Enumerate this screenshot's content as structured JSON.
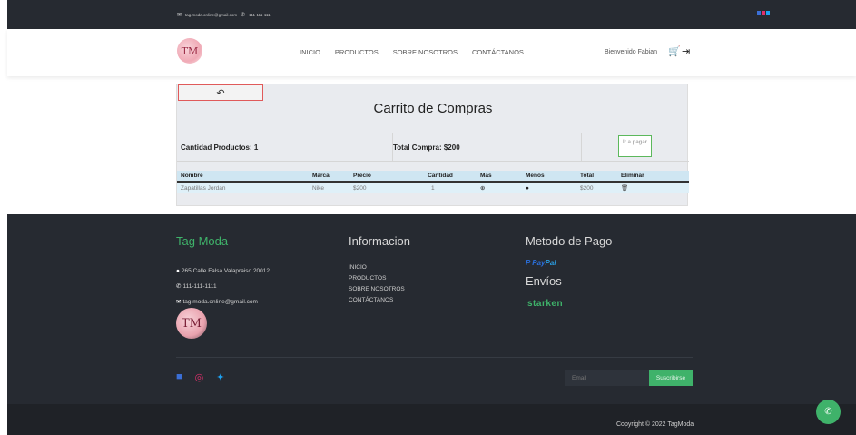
{
  "topbar": {
    "email": "tag.moda.online@gmail.com",
    "phone": "111-111-111",
    "email_icon": "envelope-icon",
    "phone_icon": "phone-icon"
  },
  "header": {
    "logo_text": "TM",
    "nav": [
      "INICIO",
      "PRODUCTOS",
      "SOBRE NOSOTROS",
      "CONTÁCTANOS"
    ],
    "welcome": "Bienvenido Fabian",
    "cart_icon": "cart-icon",
    "logout_icon": "logout-icon"
  },
  "cart": {
    "back_icon": "undo-icon",
    "title": "Carrito de Compras",
    "quantity_label": "Cantidad Productos: 1",
    "total_label": "Total Compra: $200",
    "pay_button": "Ir a pagar",
    "columns": [
      "Nombre",
      "Marca",
      "Precio",
      "Cantidad",
      "Mas",
      "Menos",
      "Total",
      "Eliminar"
    ],
    "rows": [
      {
        "nombre": "Zapatillas Jordan",
        "marca": "Nike",
        "precio": "$200",
        "cantidad": "1",
        "total": "$200"
      }
    ]
  },
  "footer": {
    "brand": "Tag Moda",
    "address": "265 Calle Falsa Valapraiso 20012",
    "phone": "111-111-1111",
    "email": "tag.moda.online@gmail.com",
    "logo_text": "TM",
    "info_title": "Informacion",
    "links": [
      "INICIO",
      "PRODUCTOS",
      "SOBRE NOSOTROS",
      "CONTÁCTANOS"
    ],
    "payment_title": "Metodo de Pago",
    "paypal_a": "Pay",
    "paypal_b": "Pal",
    "shipping_title": "Envíos",
    "shipping_brand": "starken",
    "email_placeholder": "Email",
    "subscribe": "Suscribirse",
    "copyright": "Copyright © 2022 TagModa"
  },
  "colors": {
    "accent": "#3fb26a",
    "dark": "#262a31",
    "facebook": "#3b6fd6",
    "instagram": "#e1306c",
    "twitter": "#1da1f2"
  }
}
